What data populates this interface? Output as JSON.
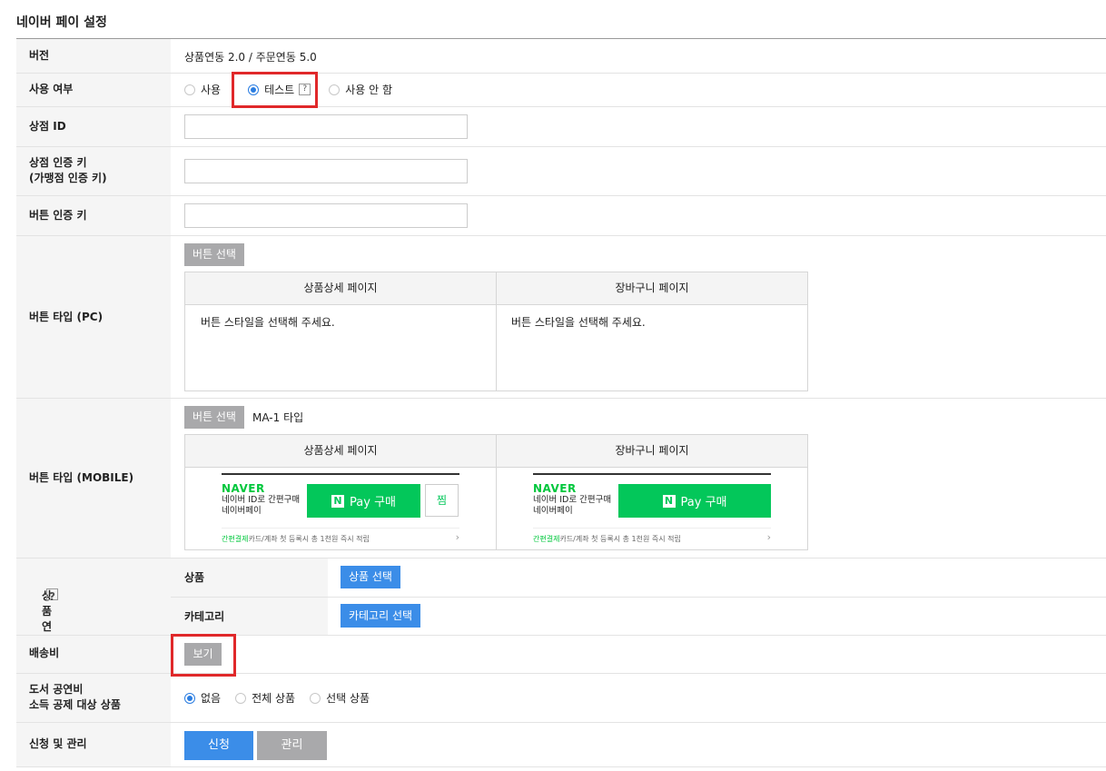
{
  "page_title": "네이버 페이 설정",
  "rows": {
    "version": {
      "label": "버전",
      "value": "상품연동 2.0 / 주문연동 5.0"
    },
    "usage": {
      "label": "사용 여부",
      "options": [
        "사용",
        "테스트",
        "사용 안 함"
      ],
      "selected": "테스트",
      "help": "?"
    },
    "store_id": {
      "label": "상점 ID",
      "value": ""
    },
    "auth_key": {
      "label_line1": "상점 인증 키",
      "label_line2": "(가맹점 인증 키)",
      "value": ""
    },
    "button_auth_key": {
      "label": "버튼 인증 키",
      "value": ""
    },
    "button_pc": {
      "label": "버튼 타입 (PC)",
      "select_button": "버튼 선택",
      "col_detail": "상품상세 페이지",
      "col_cart": "장바구니 페이지",
      "detail_text": "버튼 스타일을 선택해 주세요.",
      "cart_text": "버튼 스타일을 선택해 주세요."
    },
    "button_mobile": {
      "label": "버튼 타입 (MOBILE)",
      "select_button": "버튼 선택",
      "selected_type": "MA-1 타입",
      "col_detail": "상품상세 페이지",
      "col_cart": "장바구니 페이지",
      "preview": {
        "brand": "NAVER",
        "sub_line1": "네이버 ID로 간편구매",
        "sub_line2": "네이버페이",
        "n_logo": "N",
        "pay_label": "Pay 구매",
        "zzim": "찜",
        "promo_green": "간편결제",
        "promo_rest": "카드/계좌 첫 등록시 총 1천원 즉시 적립",
        "chevron": "›"
      }
    },
    "exclusion": {
      "label": "상품 연동 제외",
      "help": "?",
      "product_label": "상품",
      "product_button": "상품 선택",
      "category_label": "카테고리",
      "category_button": "카테고리 선택"
    },
    "shipping": {
      "label": "배송비",
      "button": "보기"
    },
    "book": {
      "label_line1": "도서 공연비",
      "label_line2": "소득 공제 대상 상품",
      "options": [
        "없음",
        "전체 상품",
        "선택 상품"
      ],
      "selected": "없음"
    },
    "apply": {
      "label": "신청 및 관리",
      "apply_button": "신청",
      "manage_button": "관리"
    }
  },
  "colors": {
    "highlight": "#e0282a",
    "naver_green": "#03c75a",
    "primary_blue": "#3b8de8",
    "gray_button": "#a9a9ab"
  }
}
